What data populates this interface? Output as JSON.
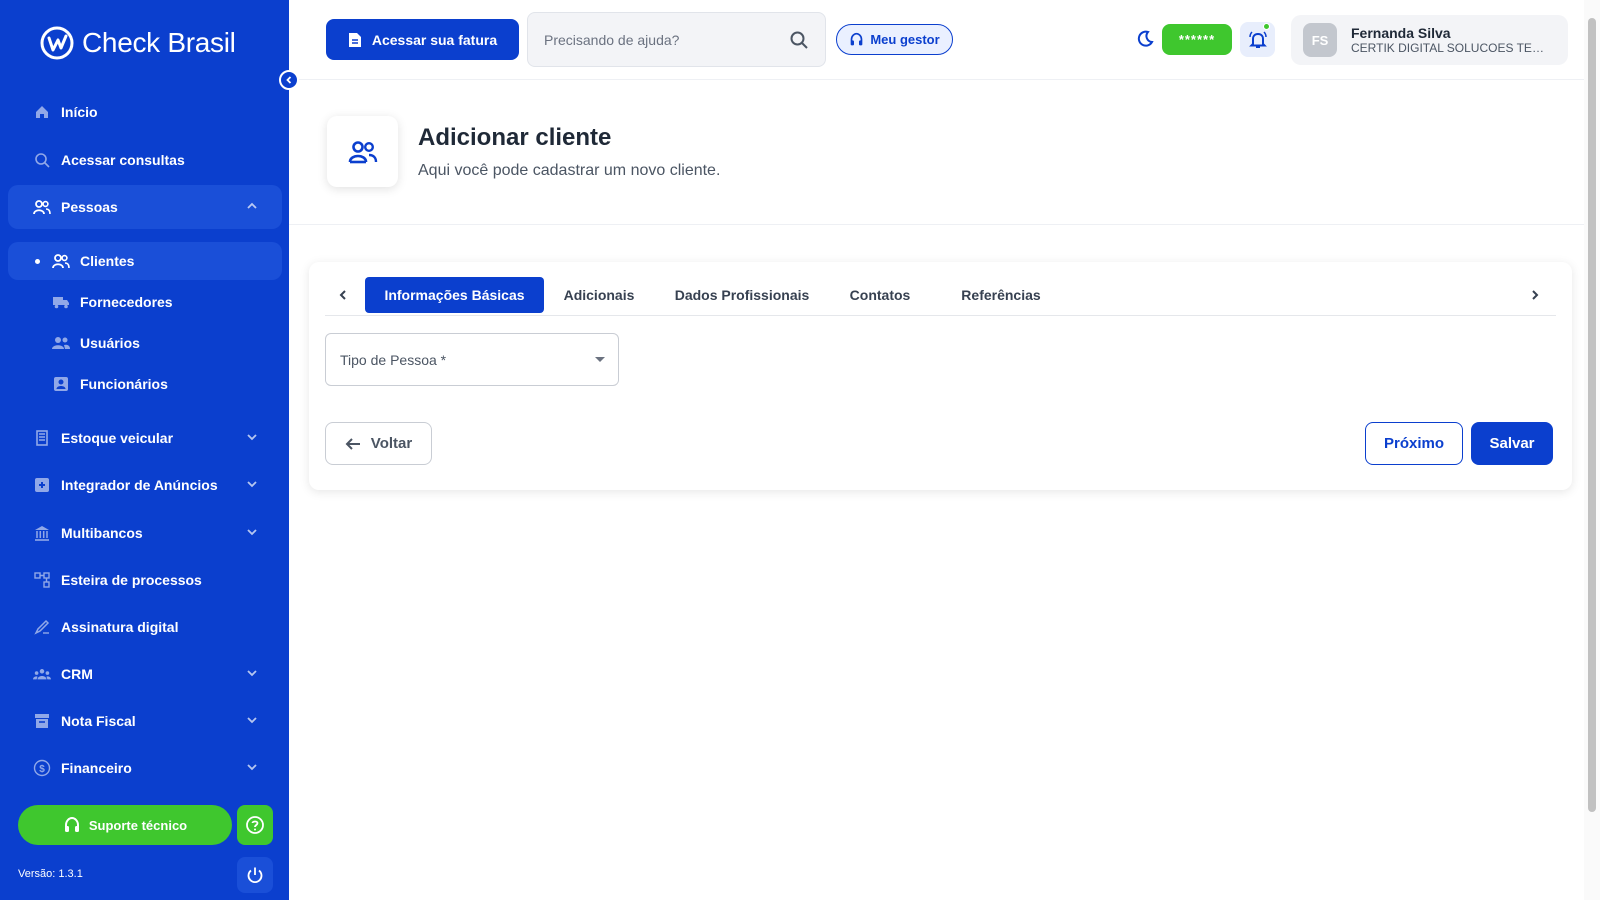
{
  "app": {
    "logo_text": "Check Brasil"
  },
  "sidebar": {
    "items": [
      {
        "label": "Início"
      },
      {
        "label": "Acessar consultas"
      },
      {
        "label": "Pessoas"
      },
      {
        "label": "Estoque veicular"
      },
      {
        "label": "Integrador de Anúncios"
      },
      {
        "label": "Multibancos"
      },
      {
        "label": "Esteira de processos"
      },
      {
        "label": "Assinatura digital"
      },
      {
        "label": "CRM"
      },
      {
        "label": "Nota Fiscal"
      },
      {
        "label": "Financeiro"
      }
    ],
    "sub_items": [
      {
        "label": "Clientes"
      },
      {
        "label": "Fornecedores"
      },
      {
        "label": "Usuários"
      },
      {
        "label": "Funcionários"
      }
    ],
    "support_label": "Suporte técnico",
    "version": "Versão: 1.3.1"
  },
  "header": {
    "invoice_label": "Acessar sua fatura",
    "search_placeholder": "Precisando de ajuda?",
    "manager_label": "Meu gestor",
    "balance_masked": "******",
    "user": {
      "initials": "FS",
      "name": "Fernanda Silva",
      "company": "CERTIK DIGITAL SOLUCOES TEC..."
    }
  },
  "page": {
    "title": "Adicionar cliente",
    "subtitle": "Aqui você pode cadastrar um novo cliente."
  },
  "form": {
    "tabs": [
      {
        "label": "Informações Básicas"
      },
      {
        "label": "Adicionais"
      },
      {
        "label": "Dados Profissionais"
      },
      {
        "label": "Contatos"
      },
      {
        "label": "Referências"
      }
    ],
    "person_type_label": "Tipo de Pessoa *",
    "back_label": "Voltar",
    "next_label": "Próximo",
    "save_label": "Salvar"
  },
  "colors": {
    "primary": "#0b3fce",
    "success": "#3fc72e"
  }
}
